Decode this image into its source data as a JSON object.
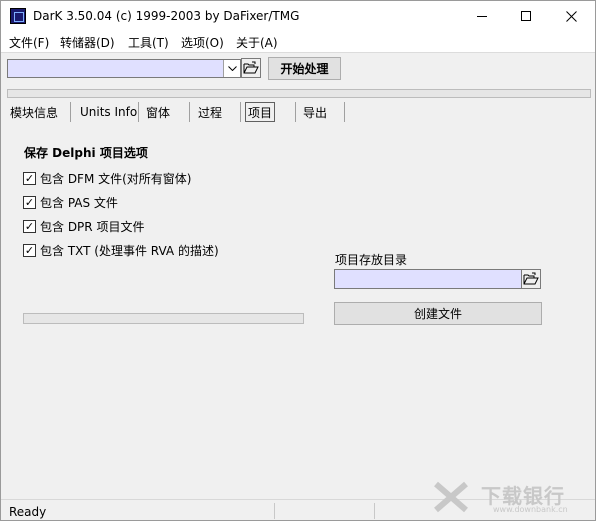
{
  "window": {
    "title": "DarK 3.50.04 (c) 1999-2003 by DaFixer/TMG"
  },
  "menu": {
    "items": [
      "文件(F)",
      "转储器(D)",
      "工具(T)",
      "选项(O)",
      "关于(A)"
    ]
  },
  "toolbar": {
    "start_label": "开始处理"
  },
  "tabs": {
    "items": [
      "模块信息",
      "Units Info",
      "窗体",
      "过程",
      "项目",
      "导出"
    ],
    "active": "项目"
  },
  "project": {
    "section_title": "保存 Delphi 项目选项",
    "options": [
      {
        "label": "包含 DFM 文件(对所有窗体)",
        "checked": true
      },
      {
        "label": "包含 PAS 文件",
        "checked": true
      },
      {
        "label": "包含 DPR 项目文件",
        "checked": true
      },
      {
        "label": "包含 TXT (处理事件 RVA 的描述)",
        "checked": true
      }
    ],
    "dir_label": "项目存放目录",
    "create_label": "创建文件"
  },
  "status": {
    "text": "Ready"
  },
  "watermark": {
    "cn": "下载银行",
    "en": "www.downbank.cn"
  },
  "colors": {
    "input_bg": "#e0e0ff",
    "window_bg": "#f0f0f0"
  }
}
